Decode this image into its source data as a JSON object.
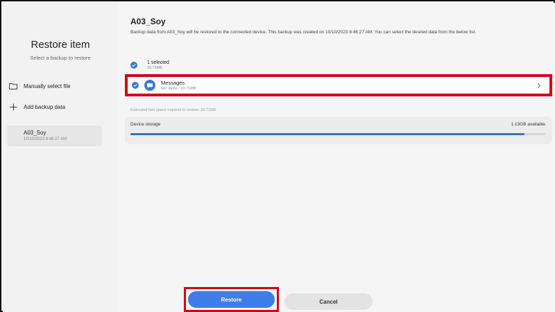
{
  "left": {
    "title": "Restore item",
    "subtitle": "Select a backup to restore",
    "actions": [
      {
        "label": "Manually select file",
        "icon": "folder-icon"
      },
      {
        "label": "Add backup data",
        "icon": "plus-icon"
      }
    ],
    "backups": [
      {
        "name": "A03_Soy",
        "date": "10/10/2023 8:46:27 AM"
      }
    ]
  },
  "main": {
    "title": "A03_Soy",
    "description": "Backup data from A03_Soy will be restored to the connected device. This backup was created on 10/10/2023 8:46:27 AM. You can select the desired data from the below list.",
    "selected": {
      "count": "1 selected",
      "size": "10.71MB"
    },
    "items": [
      {
        "name": "Messages",
        "meta": "647 items / 10.71MB",
        "checked": true
      }
    ],
    "estimated_space": "Estimated free space required to restore: 10.71MB",
    "storage": {
      "label": "Device storage",
      "available": "1.13GB available",
      "used_fraction": 0.95
    }
  },
  "buttons": {
    "restore": "Restore",
    "cancel": "Cancel"
  },
  "colors": {
    "accent": "#3d7ee8",
    "highlight": "#d0021b"
  }
}
